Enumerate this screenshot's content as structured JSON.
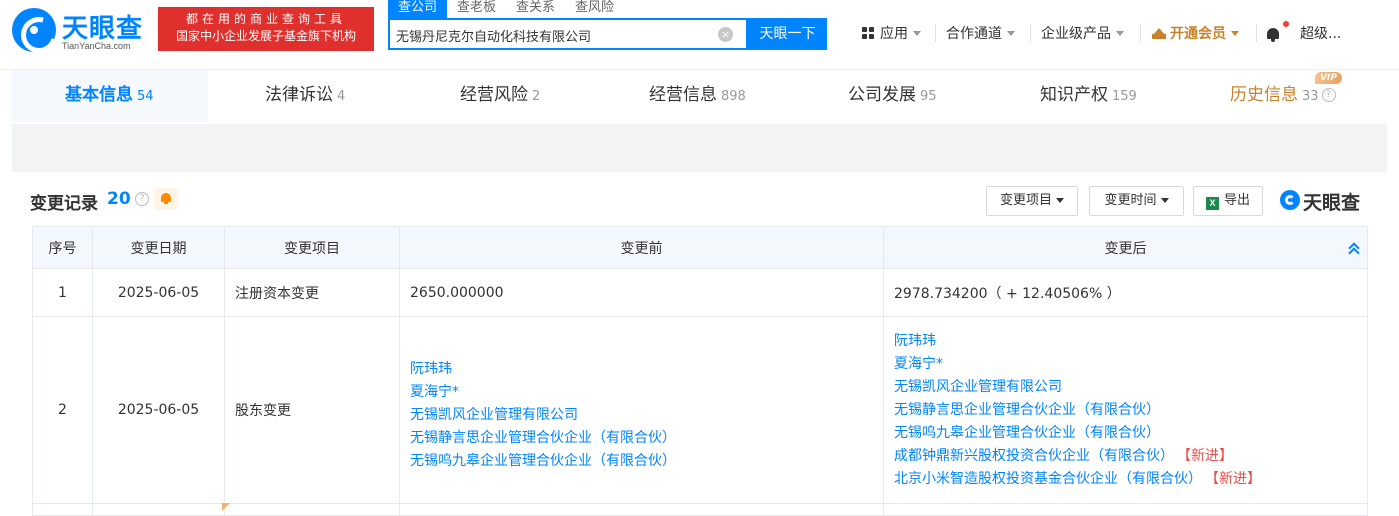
{
  "header": {
    "logo_text": "天眼查",
    "logo_sub": "TianYanCha.com",
    "promo_line1": "都在用的商业查询工具",
    "promo_line2": "国家中小企业发展子基金旗下机构",
    "search_tabs": [
      "查公司",
      "查老板",
      "查关系",
      "查风险"
    ],
    "search_value": "无锡丹尼克尔自动化科技有限公司",
    "clear_label": "×",
    "search_button": "天眼一下",
    "nav": {
      "apps": "应用",
      "partner": "合作通道",
      "enterprise": "企业级产品",
      "vip": "开通会员",
      "user": "超级..."
    }
  },
  "tabs": [
    {
      "label": "基本信息",
      "count": "54"
    },
    {
      "label": "法律诉讼",
      "count": "4"
    },
    {
      "label": "经营风险",
      "count": "2"
    },
    {
      "label": "经营信息",
      "count": "898"
    },
    {
      "label": "公司发展",
      "count": "95"
    },
    {
      "label": "知识产权",
      "count": "159"
    },
    {
      "label": "历史信息",
      "count": "33"
    }
  ],
  "vip_badge": "VIP",
  "help_glyph": "?",
  "section": {
    "title": "变更记录",
    "count": "20",
    "filter_item": "变更项目",
    "filter_time": "变更时间",
    "export": "导出",
    "excel_glyph": "X",
    "watermark": "天眼查"
  },
  "table": {
    "headers": [
      "序号",
      "变更日期",
      "变更项目",
      "变更前",
      "变更后"
    ],
    "rows": [
      {
        "no": "1",
        "date": "2025-06-05",
        "item": "注册资本变更",
        "before": "2650.000000",
        "after": "2978.734200（ + 12.40506% ）"
      },
      {
        "no": "2",
        "date": "2025-06-05",
        "item": "股东变更",
        "before": [
          "阮玮玮",
          "夏海宁*",
          "无锡凯风企业管理有限公司",
          "无锡静言思企业管理合伙企业（有限合伙）",
          "无锡呜九皋企业管理合伙企业（有限合伙）"
        ],
        "after": [
          "阮玮玮",
          "夏海宁*",
          "无锡凯风企业管理有限公司",
          "无锡静言思企业管理合伙企业（有限合伙）",
          "无锡呜九皋企业管理合伙企业（有限合伙）",
          "成都钟鼎新兴股权投资合伙企业（有限合伙）",
          "北京小米智造股权投资基金合伙企业（有限合伙）"
        ],
        "new_tag": "【新进】"
      }
    ]
  }
}
